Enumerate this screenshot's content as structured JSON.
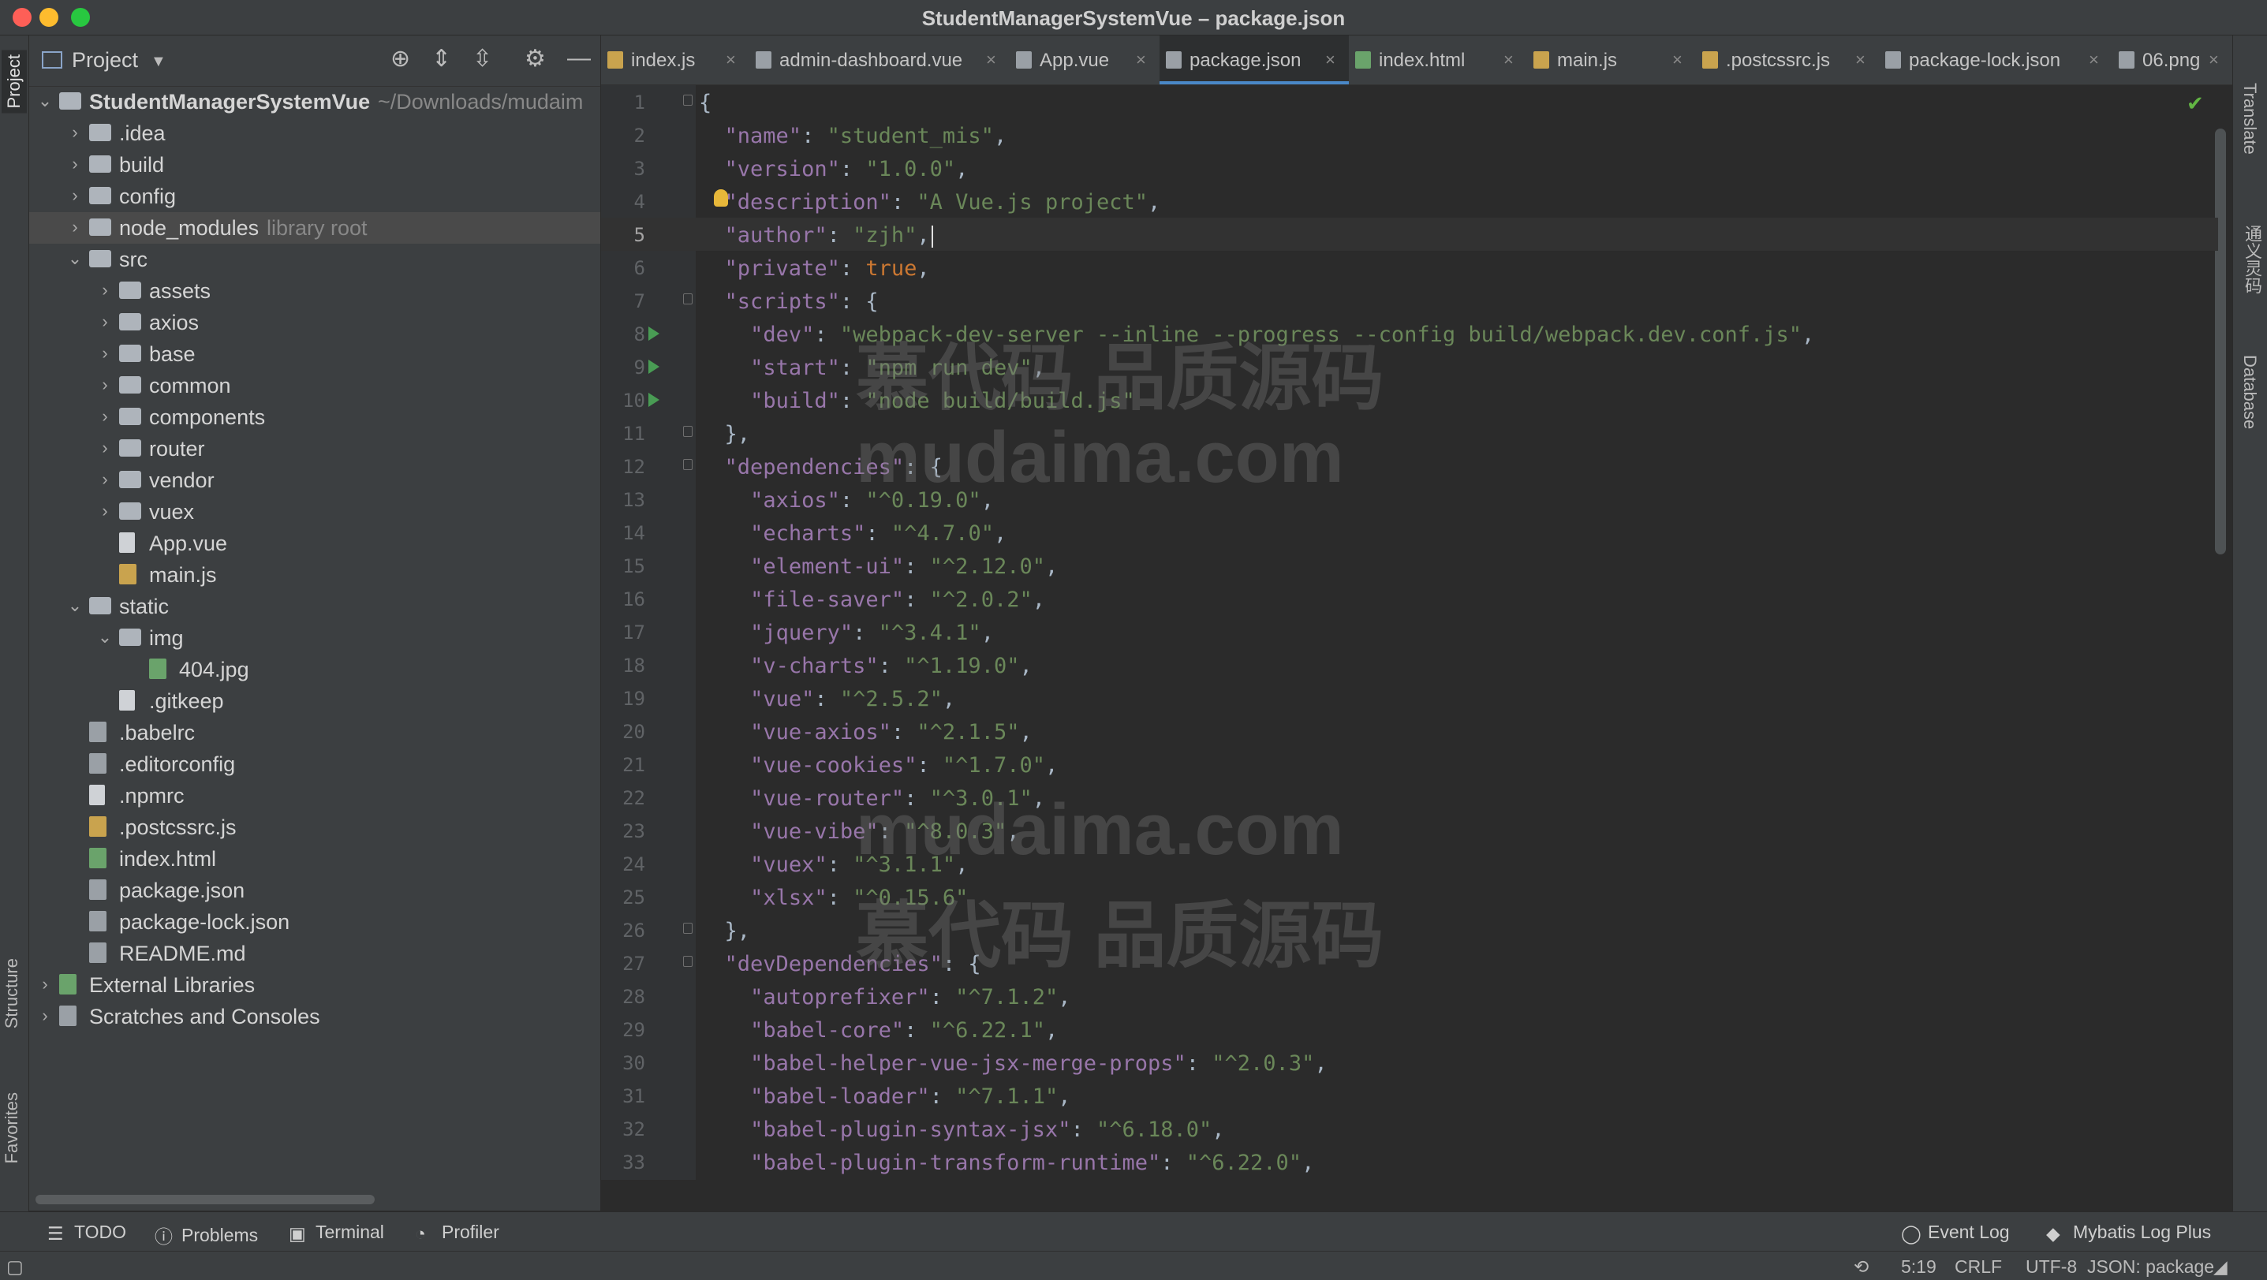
{
  "window": {
    "title": "StudentManagerSystemVue – package.json"
  },
  "left_strip": {
    "project_tab": "Project",
    "structure_tab": "Structure",
    "favorites_tab": "Favorites"
  },
  "project_panel": {
    "title": "Project",
    "tree": [
      {
        "label": "StudentManagerSystemVue",
        "hint": "~/Downloads/mudaim",
        "depth": 0,
        "arrow": "open",
        "icon": "folder-module",
        "bold": true
      },
      {
        "label": ".idea",
        "depth": 1,
        "arrow": "closed",
        "icon": "folder"
      },
      {
        "label": "build",
        "depth": 1,
        "arrow": "closed",
        "icon": "folder"
      },
      {
        "label": "config",
        "depth": 1,
        "arrow": "closed",
        "icon": "folder"
      },
      {
        "label": "node_modules",
        "hint": "library root",
        "depth": 1,
        "arrow": "closed",
        "icon": "folder",
        "selected": true
      },
      {
        "label": "src",
        "depth": 1,
        "arrow": "open",
        "icon": "folder"
      },
      {
        "label": "assets",
        "depth": 2,
        "arrow": "closed",
        "icon": "folder"
      },
      {
        "label": "axios",
        "depth": 2,
        "arrow": "closed",
        "icon": "folder"
      },
      {
        "label": "base",
        "depth": 2,
        "arrow": "closed",
        "icon": "folder"
      },
      {
        "label": "common",
        "depth": 2,
        "arrow": "closed",
        "icon": "folder"
      },
      {
        "label": "components",
        "depth": 2,
        "arrow": "closed",
        "icon": "folder"
      },
      {
        "label": "router",
        "depth": 2,
        "arrow": "closed",
        "icon": "folder"
      },
      {
        "label": "vendor",
        "depth": 2,
        "arrow": "closed",
        "icon": "folder"
      },
      {
        "label": "vuex",
        "depth": 2,
        "arrow": "closed",
        "icon": "folder"
      },
      {
        "label": "App.vue",
        "depth": 2,
        "arrow": "none",
        "icon": "file"
      },
      {
        "label": "main.js",
        "depth": 2,
        "arrow": "none",
        "icon": "file-js"
      },
      {
        "label": "static",
        "depth": 1,
        "arrow": "open",
        "icon": "folder"
      },
      {
        "label": "img",
        "depth": 2,
        "arrow": "open",
        "icon": "folder"
      },
      {
        "label": "404.jpg",
        "depth": 3,
        "arrow": "none",
        "icon": "file-image"
      },
      {
        "label": ".gitkeep",
        "depth": 2,
        "arrow": "none",
        "icon": "file"
      },
      {
        "label": ".babelrc",
        "depth": 1,
        "arrow": "none",
        "icon": "file-json"
      },
      {
        "label": ".editorconfig",
        "depth": 1,
        "arrow": "none",
        "icon": "gear"
      },
      {
        "label": ".npmrc",
        "depth": 1,
        "arrow": "none",
        "icon": "file"
      },
      {
        "label": ".postcssrc.js",
        "depth": 1,
        "arrow": "none",
        "icon": "file-js"
      },
      {
        "label": "index.html",
        "depth": 1,
        "arrow": "none",
        "icon": "file-html"
      },
      {
        "label": "package.json",
        "depth": 1,
        "arrow": "none",
        "icon": "file-json"
      },
      {
        "label": "package-lock.json",
        "depth": 1,
        "arrow": "none",
        "icon": "file-json"
      },
      {
        "label": "README.md",
        "depth": 1,
        "arrow": "none",
        "icon": "file-md"
      },
      {
        "label": "External Libraries",
        "depth": 0,
        "arrow": "closed",
        "icon": "libraries"
      },
      {
        "label": "Scratches and Consoles",
        "depth": 0,
        "arrow": "closed",
        "icon": "scratches"
      }
    ]
  },
  "tabs": [
    {
      "label": "index.js",
      "icon": "file-js"
    },
    {
      "label": "admin-dashboard.vue",
      "icon": "file"
    },
    {
      "label": "App.vue",
      "icon": "file"
    },
    {
      "label": "package.json",
      "icon": "file-json",
      "active": true
    },
    {
      "label": "index.html",
      "icon": "file-html"
    },
    {
      "label": "main.js",
      "icon": "file-js"
    },
    {
      "label": ".postcssrc.js",
      "icon": "file-js"
    },
    {
      "label": "package-lock.json",
      "icon": "file-json"
    },
    {
      "label": "06.png",
      "icon": "file-image"
    }
  ],
  "editor": {
    "current_line": 5,
    "lines": [
      "{",
      "  \"name\": \"student_mis\",",
      "  \"version\": \"1.0.0\",",
      "  \"description\": \"A Vue.js project\",",
      "  \"author\": \"zjh\",",
      "  \"private\": true,",
      "  \"scripts\": {",
      "    \"dev\": \"webpack-dev-server --inline --progress --config build/webpack.dev.conf.js\",",
      "    \"start\": \"npm run dev\",",
      "    \"build\": \"node build/build.js\"",
      "  },",
      "  \"dependencies\": {",
      "    \"axios\": \"^0.19.0\",",
      "    \"echarts\": \"^4.7.0\",",
      "    \"element-ui\": \"^2.12.0\",",
      "    \"file-saver\": \"^2.0.2\",",
      "    \"jquery\": \"^3.4.1\",",
      "    \"v-charts\": \"^1.19.0\",",
      "    \"vue\": \"^2.5.2\",",
      "    \"vue-axios\": \"^2.1.5\",",
      "    \"vue-cookies\": \"^1.7.0\",",
      "    \"vue-router\": \"^3.0.1\",",
      "    \"vue-vibe\": \"^8.0.3\",",
      "    \"vuex\": \"^3.1.1\",",
      "    \"xlsx\": \"^0.15.6\"",
      "  },",
      "  \"devDependencies\": {",
      "    \"autoprefixer\": \"^7.1.2\",",
      "    \"babel-core\": \"^6.22.1\",",
      "    \"babel-helper-vue-jsx-merge-props\": \"^2.0.3\",",
      "    \"babel-loader\": \"^7.1.1\",",
      "    \"babel-plugin-syntax-jsx\": \"^6.18.0\",",
      "    \"babel-plugin-transform-runtime\": \"^6.22.0\","
    ],
    "run_lines": [
      8,
      9,
      10
    ],
    "fold_lines": [
      1,
      7,
      11,
      12,
      26,
      27
    ],
    "bulb_line": 4
  },
  "watermarks": [
    "慕代码 品质源码",
    "mudaima.com",
    "mudaima.com",
    "慕代码 品质源码"
  ],
  "right_strip": {
    "translate_tab": "Translate",
    "ai_tab": "通义灵码",
    "database_tab": "Database"
  },
  "bottom_tools": {
    "todo": "TODO",
    "problems": "Problems",
    "terminal": "Terminal",
    "profiler": "Profiler",
    "event_log": "Event Log",
    "mybatis": "Mybatis Log Plus"
  },
  "status": {
    "position": "5:19",
    "line_sep": "CRLF",
    "encoding": "UTF-8",
    "schema": "JSON: package"
  },
  "colors": {
    "accent": "#4a88c7",
    "string": "#6a8759",
    "key": "#9876aa",
    "keyword": "#cc7832",
    "run": "#499c54"
  }
}
